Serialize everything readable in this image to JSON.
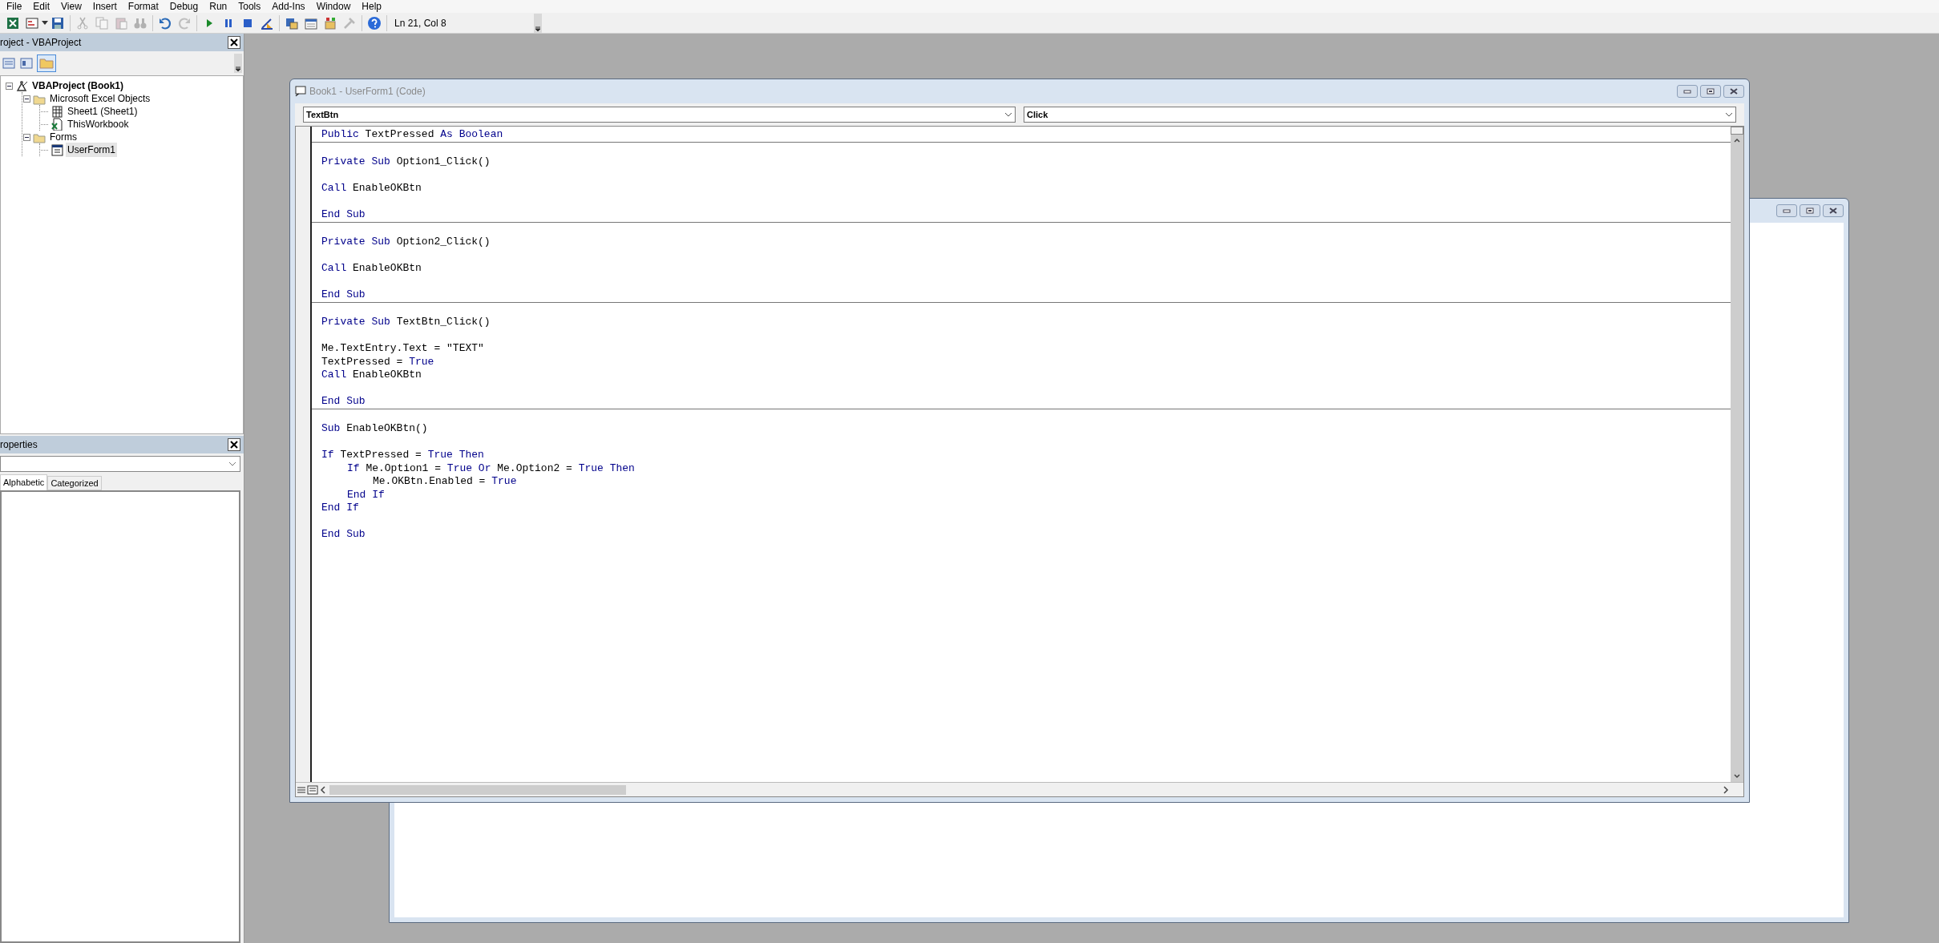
{
  "menu_bar": [
    "File",
    "Edit",
    "View",
    "Insert",
    "Format",
    "Debug",
    "Run",
    "Tools",
    "Add-Ins",
    "Window",
    "Help"
  ],
  "toolbar": {
    "position": "Ln 21, Col 8"
  },
  "project_explorer": {
    "title": "roject - VBAProject",
    "tree": [
      {
        "label": "VBAProject (Book1)",
        "kind": "project",
        "expanded": true,
        "selected": false,
        "children": [
          {
            "label": "Microsoft Excel Objects",
            "kind": "folder",
            "expanded": true,
            "selected": false,
            "children": [
              {
                "label": "Sheet1 (Sheet1)",
                "kind": "sheet",
                "selected": false
              },
              {
                "label": "ThisWorkbook",
                "kind": "workbook",
                "selected": false
              }
            ]
          },
          {
            "label": "Forms",
            "kind": "folder",
            "expanded": true,
            "selected": false,
            "children": [
              {
                "label": "UserForm1",
                "kind": "userform",
                "selected": true
              }
            ]
          }
        ]
      }
    ]
  },
  "properties": {
    "title": "roperties",
    "tabs": [
      {
        "label": "Alphabetic",
        "selected": true
      },
      {
        "label": "Categorized",
        "selected": false
      }
    ]
  },
  "code_window": {
    "title": "Book1 - UserForm1 (Code)",
    "object": "TextBtn",
    "procedure": "Click",
    "sections": [
      {
        "lines": [
          {
            "kind": "code",
            "segments": [
              {
                "kind": "keyword",
                "text": "Public"
              },
              {
                "kind": "plain",
                "text": " TextPressed "
              },
              {
                "kind": "keyword",
                "text": "As Boolean"
              }
            ]
          }
        ]
      },
      {
        "lines": [
          {
            "kind": "blank"
          },
          {
            "kind": "code",
            "segments": [
              {
                "kind": "keyword",
                "text": "Private Sub"
              },
              {
                "kind": "plain",
                "text": " Option1_Click()"
              }
            ]
          },
          {
            "kind": "blank"
          },
          {
            "kind": "code",
            "segments": [
              {
                "kind": "keyword",
                "text": "Call"
              },
              {
                "kind": "plain",
                "text": " EnableOKBtn"
              }
            ]
          },
          {
            "kind": "blank"
          },
          {
            "kind": "code",
            "segments": [
              {
                "kind": "keyword",
                "text": "End Sub"
              }
            ]
          }
        ]
      },
      {
        "lines": [
          {
            "kind": "blank"
          },
          {
            "kind": "code",
            "segments": [
              {
                "kind": "keyword",
                "text": "Private Sub"
              },
              {
                "kind": "plain",
                "text": " Option2_Click()"
              }
            ]
          },
          {
            "kind": "blank"
          },
          {
            "kind": "code",
            "segments": [
              {
                "kind": "keyword",
                "text": "Call"
              },
              {
                "kind": "plain",
                "text": " EnableOKBtn"
              }
            ]
          },
          {
            "kind": "blank"
          },
          {
            "kind": "code",
            "segments": [
              {
                "kind": "keyword",
                "text": "End Sub"
              }
            ]
          }
        ]
      },
      {
        "lines": [
          {
            "kind": "blank"
          },
          {
            "kind": "code",
            "segments": [
              {
                "kind": "keyword",
                "text": "Private Sub"
              },
              {
                "kind": "plain",
                "text": " TextBtn_Click()"
              }
            ]
          },
          {
            "kind": "blank"
          },
          {
            "kind": "code",
            "segments": [
              {
                "kind": "plain",
                "text": "Me.TextEntry.Text = \"TEXT\""
              }
            ]
          },
          {
            "kind": "code",
            "segments": [
              {
                "kind": "plain",
                "text": "TextPressed = "
              },
              {
                "kind": "keyword",
                "text": "True"
              }
            ]
          },
          {
            "kind": "code",
            "segments": [
              {
                "kind": "keyword",
                "text": "Call"
              },
              {
                "kind": "plain",
                "text": " EnableOKBtn"
              }
            ]
          },
          {
            "kind": "blank"
          },
          {
            "kind": "code",
            "segments": [
              {
                "kind": "keyword",
                "text": "End Sub"
              }
            ]
          }
        ]
      },
      {
        "lines": [
          {
            "kind": "blank"
          },
          {
            "kind": "code",
            "segments": [
              {
                "kind": "keyword",
                "text": "Sub"
              },
              {
                "kind": "plain",
                "text": " EnableOKBtn()"
              }
            ]
          },
          {
            "kind": "blank"
          },
          {
            "kind": "code",
            "segments": [
              {
                "kind": "keyword",
                "text": "If"
              },
              {
                "kind": "plain",
                "text": " TextPressed = "
              },
              {
                "kind": "keyword",
                "text": "True Then"
              }
            ],
            "children": [
              {
                "kind": "code",
                "segments": [
                  {
                    "kind": "keyword",
                    "text": "If"
                  },
                  {
                    "kind": "plain",
                    "text": " Me.Option1 = "
                  },
                  {
                    "kind": "keyword",
                    "text": "True Or"
                  },
                  {
                    "kind": "plain",
                    "text": " Me.Option2 = "
                  },
                  {
                    "kind": "keyword",
                    "text": "True Then"
                  }
                ],
                "children": [
                  {
                    "kind": "code",
                    "segments": [
                      {
                        "kind": "plain",
                        "text": "Me.OKBtn.Enabled = "
                      },
                      {
                        "kind": "keyword",
                        "text": "True"
                      }
                    ]
                  }
                ]
              },
              {
                "kind": "code",
                "segments": [
                  {
                    "kind": "keyword",
                    "text": "End If"
                  }
                ]
              }
            ]
          },
          {
            "kind": "code",
            "segments": [
              {
                "kind": "keyword",
                "text": "End If"
              }
            ]
          },
          {
            "kind": "blank"
          },
          {
            "kind": "code",
            "segments": [
              {
                "kind": "keyword",
                "text": "End Sub"
              }
            ]
          }
        ]
      }
    ]
  }
}
